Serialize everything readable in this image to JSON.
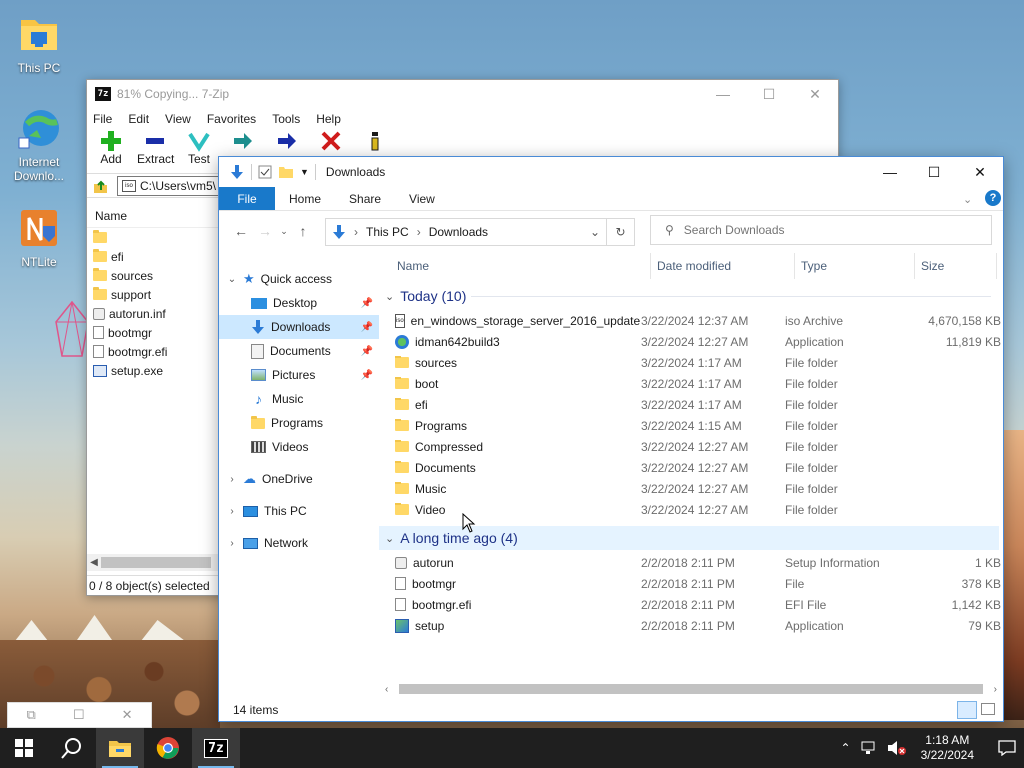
{
  "desktop": {
    "icons": [
      {
        "label": "This PC"
      },
      {
        "label": "Internet Downlo..."
      },
      {
        "label": "NTLite"
      }
    ]
  },
  "zip_window": {
    "title": "81% Copying... 7-Zip",
    "app_badge": "7z",
    "menu": [
      "File",
      "Edit",
      "View",
      "Favorites",
      "Tools",
      "Help"
    ],
    "toolbar": [
      "Add",
      "Extract",
      "Test"
    ],
    "path": "C:\\Users\\vm5\\",
    "column_name": "Name",
    "files": [
      {
        "name": "",
        "kind": "folder"
      },
      {
        "name": "efi",
        "kind": "folder"
      },
      {
        "name": "sources",
        "kind": "folder"
      },
      {
        "name": "support",
        "kind": "folder"
      },
      {
        "name": "autorun.inf",
        "kind": "inf"
      },
      {
        "name": "bootmgr",
        "kind": "file"
      },
      {
        "name": "bootmgr.efi",
        "kind": "file"
      },
      {
        "name": "setup.exe",
        "kind": "exe"
      }
    ],
    "status": "0 / 8 object(s) selected"
  },
  "explorer": {
    "title": "Downloads",
    "ribbon": {
      "file": "File",
      "tabs": [
        "Home",
        "Share",
        "View"
      ]
    },
    "address": {
      "root": "This PC",
      "current": "Downloads"
    },
    "search": {
      "placeholder": "Search Downloads"
    },
    "nav": {
      "quick_access": "Quick access",
      "quick_items": [
        {
          "label": "Desktop",
          "pinned": true
        },
        {
          "label": "Downloads",
          "pinned": true
        },
        {
          "label": "Documents",
          "pinned": true
        },
        {
          "label": "Pictures",
          "pinned": true
        },
        {
          "label": "Music",
          "pinned": false
        },
        {
          "label": "Programs",
          "pinned": false
        },
        {
          "label": "Videos",
          "pinned": false
        }
      ],
      "onedrive": "OneDrive",
      "thispc": "This PC",
      "network": "Network"
    },
    "columns": {
      "name": "Name",
      "date": "Date modified",
      "type": "Type",
      "size": "Size"
    },
    "groups": [
      {
        "label": "Today (10)",
        "rows": [
          {
            "name": "en_windows_storage_server_2016_update...",
            "date": "3/22/2024 12:37 AM",
            "type": "iso Archive",
            "size": "4,670,158 KB",
            "icon": "iso"
          },
          {
            "name": "idman642build3",
            "date": "3/22/2024 12:27 AM",
            "type": "Application",
            "size": "11,819 KB",
            "icon": "app"
          },
          {
            "name": "sources",
            "date": "3/22/2024 1:17 AM",
            "type": "File folder",
            "size": "",
            "icon": "folder"
          },
          {
            "name": "boot",
            "date": "3/22/2024 1:17 AM",
            "type": "File folder",
            "size": "",
            "icon": "folder"
          },
          {
            "name": "efi",
            "date": "3/22/2024 1:17 AM",
            "type": "File folder",
            "size": "",
            "icon": "folder"
          },
          {
            "name": "Programs",
            "date": "3/22/2024 1:15 AM",
            "type": "File folder",
            "size": "",
            "icon": "folder"
          },
          {
            "name": "Compressed",
            "date": "3/22/2024 12:27 AM",
            "type": "File folder",
            "size": "",
            "icon": "folder"
          },
          {
            "name": "Documents",
            "date": "3/22/2024 12:27 AM",
            "type": "File folder",
            "size": "",
            "icon": "folder"
          },
          {
            "name": "Music",
            "date": "3/22/2024 12:27 AM",
            "type": "File folder",
            "size": "",
            "icon": "folder"
          },
          {
            "name": "Video",
            "date": "3/22/2024 12:27 AM",
            "type": "File folder",
            "size": "",
            "icon": "folder"
          }
        ]
      },
      {
        "label": "A long time ago (4)",
        "rows": [
          {
            "name": "autorun",
            "date": "2/2/2018 2:11 PM",
            "type": "Setup Information",
            "size": "1 KB",
            "icon": "inf"
          },
          {
            "name": "bootmgr",
            "date": "2/2/2018 2:11 PM",
            "type": "File",
            "size": "378 KB",
            "icon": "file"
          },
          {
            "name": "bootmgr.efi",
            "date": "2/2/2018 2:11 PM",
            "type": "EFI File",
            "size": "1,142 KB",
            "icon": "file"
          },
          {
            "name": "setup",
            "date": "2/2/2018 2:11 PM",
            "type": "Application",
            "size": "79 KB",
            "icon": "setup"
          }
        ]
      }
    ],
    "status": "14 items"
  },
  "taskbar": {
    "time": "1:18 AM",
    "date": "3/22/2024",
    "zip_label": "7z"
  },
  "colors": {
    "accent": "#1979ca",
    "group_text": "#1e3287",
    "selected": "#cce8ff",
    "hover": "#e5f3ff"
  }
}
